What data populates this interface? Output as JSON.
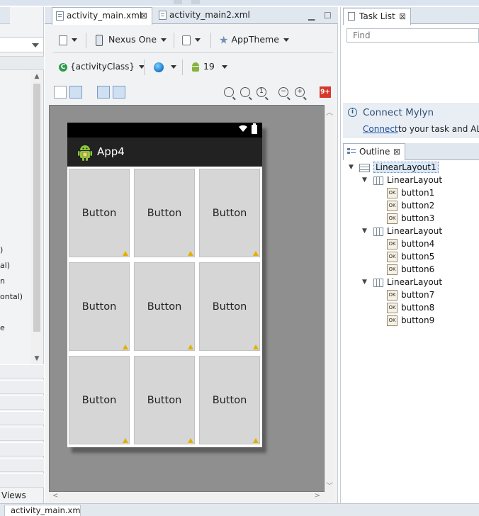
{
  "editor": {
    "tabs": [
      {
        "label": "activity_main.xml",
        "close": "⊠"
      },
      {
        "label": "activity_main2.xml",
        "close": ""
      }
    ],
    "toolbar": {
      "device": "Nexus One",
      "theme": "AppTheme",
      "activity": "{activityClass}",
      "api_level": "19",
      "error_badge": "9+"
    }
  },
  "device_preview": {
    "app_title": "App4",
    "buttons": [
      "Button",
      "Button",
      "Button",
      "Button",
      "Button",
      "Button",
      "Button",
      "Button",
      "Button"
    ]
  },
  "task_list": {
    "tab_label": "Task List",
    "close": "⊠",
    "find_placeholder": "Find"
  },
  "mylyn": {
    "title": "Connect Mylyn",
    "link": "Connect",
    "text": "to your task and ALM"
  },
  "outline": {
    "tab_label": "Outline",
    "close": "⊠",
    "root": "LinearLayout1",
    "groups": [
      {
        "label": "LinearLayout",
        "children": [
          "button1",
          "button2",
          "button3"
        ]
      },
      {
        "label": "LinearLayout",
        "children": [
          "button4",
          "button5",
          "button6"
        ]
      },
      {
        "label": "LinearLayout",
        "children": [
          "button7",
          "button8",
          "button9"
        ]
      }
    ]
  },
  "palette": {
    "fragments": [
      ")",
      "al)",
      "n",
      "ontal)",
      "e"
    ],
    "views_label": "Views"
  },
  "bottom_tab": {
    "label": "activity_main.xml"
  },
  "colors": {
    "canvas": "#8f8f8f",
    "actionbar": "#222222",
    "button_bg": "#d6d6d6",
    "link": "#1a4d9c"
  }
}
